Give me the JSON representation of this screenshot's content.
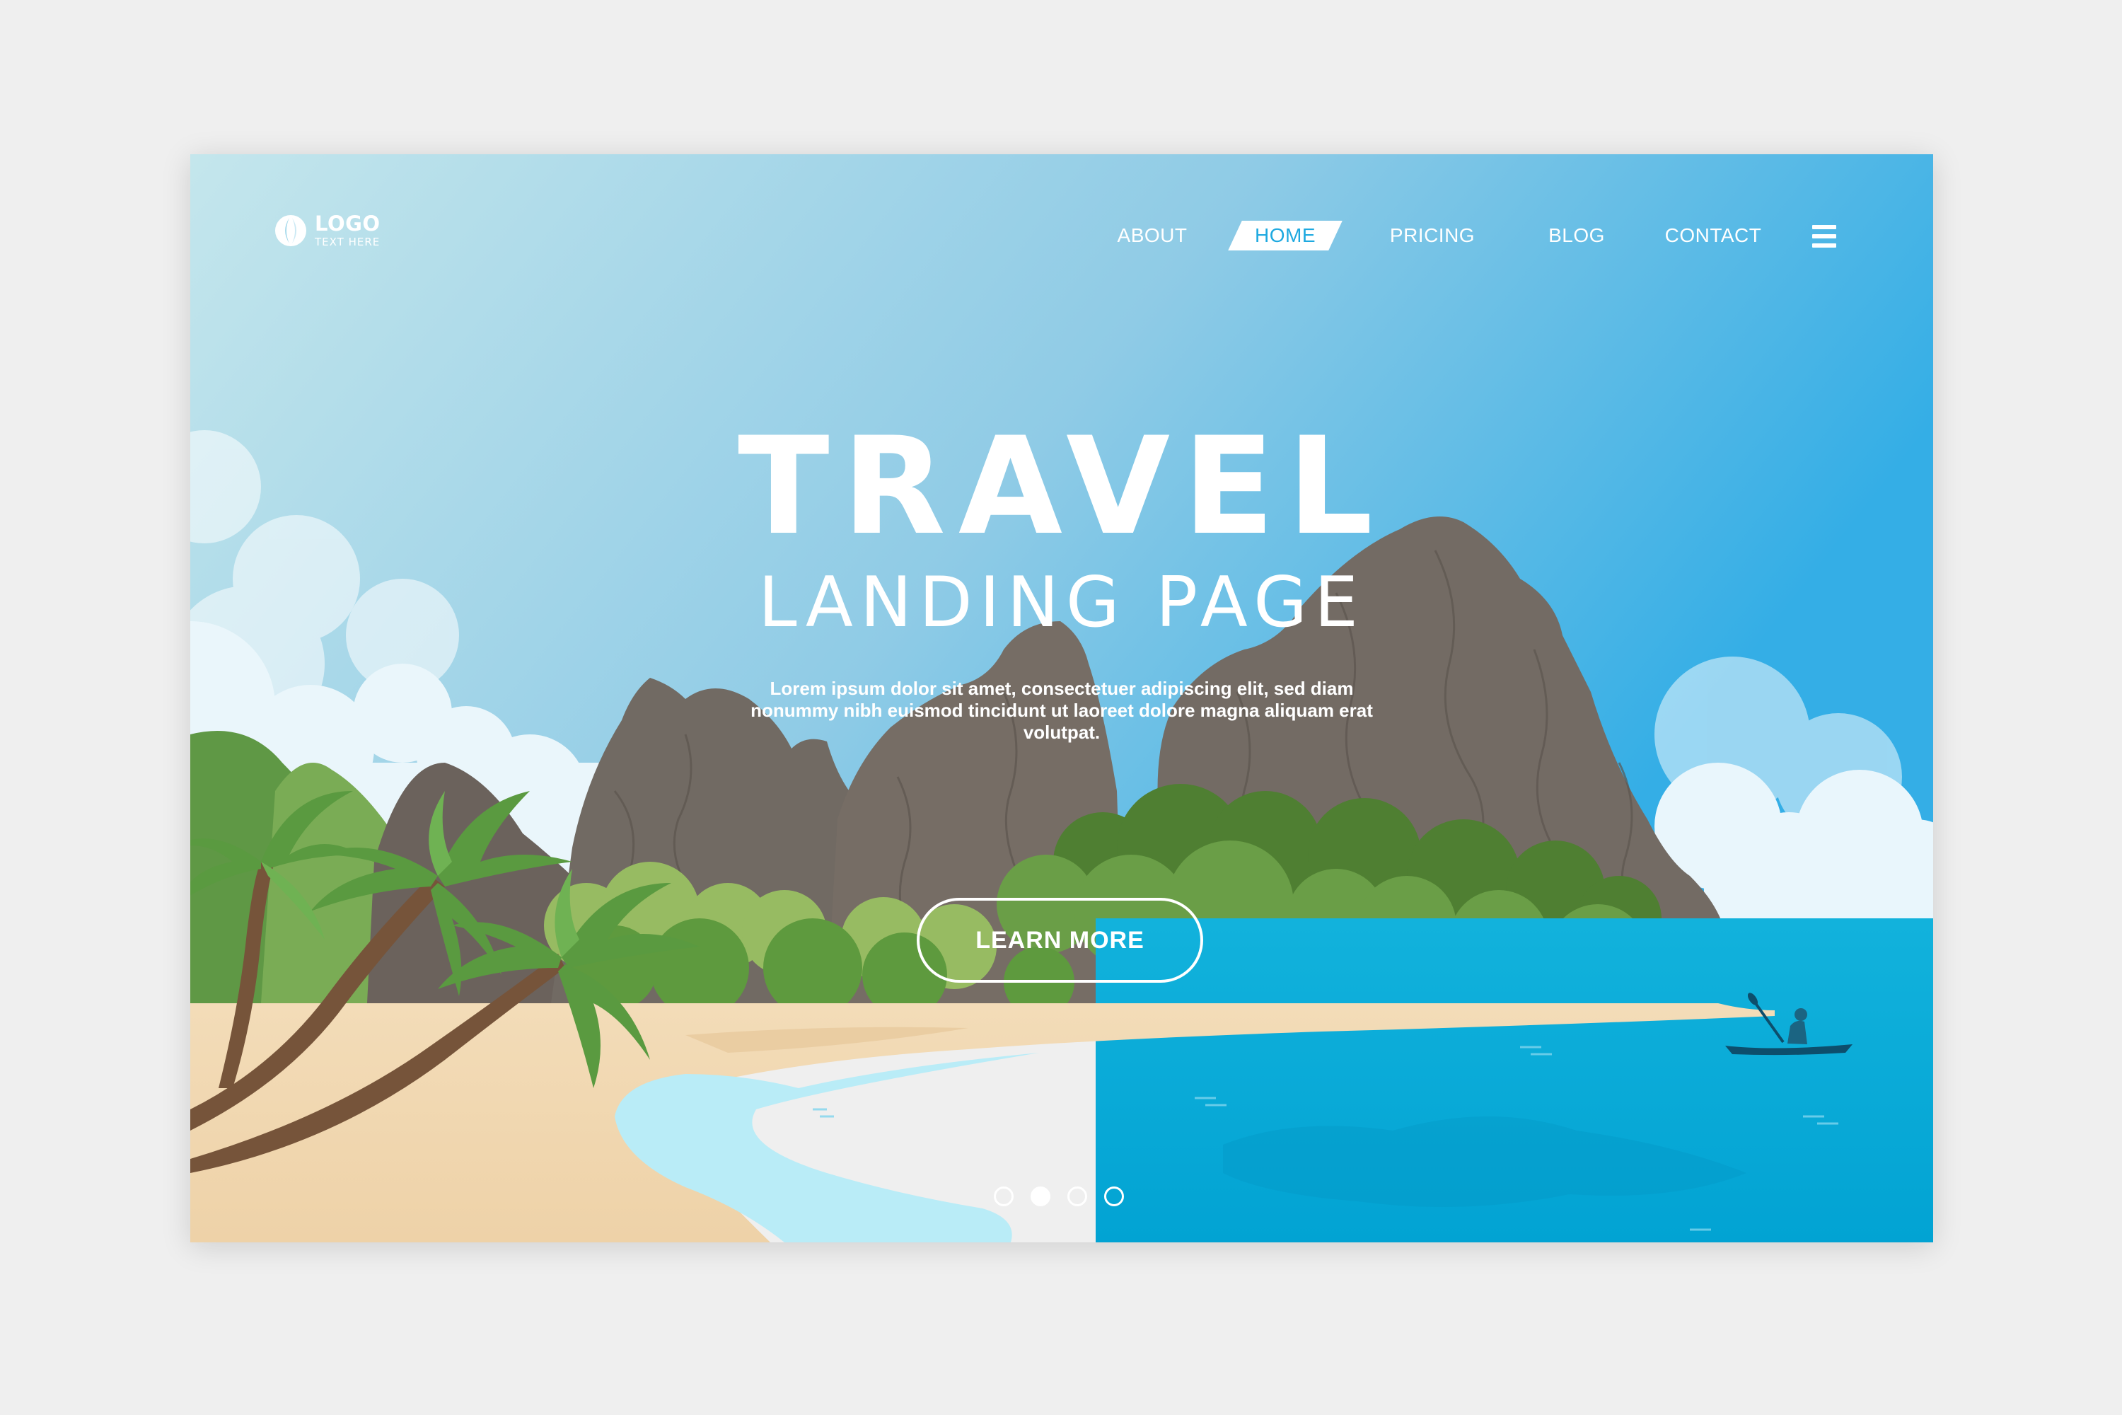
{
  "logo": {
    "title": "LOGO",
    "subtitle": "TEXT HERE",
    "icon": "logo-mark-icon"
  },
  "nav": {
    "items": [
      {
        "label": "ABOUT",
        "active": false
      },
      {
        "label": "HOME",
        "active": true
      },
      {
        "label": "PRICING",
        "active": false
      },
      {
        "label": "BLOG",
        "active": false
      },
      {
        "label": "CONTACT",
        "active": false
      }
    ],
    "menu_icon": "hamburger-menu-icon"
  },
  "hero": {
    "title": "TRAVEL",
    "subtitle": "LANDING PAGE",
    "body": "Lorem ipsum dolor sit amet, consectetuer adipiscing elit, sed diam nonummy nibh euismod tincidunt ut laoreet dolore magna aliquam erat volutpat.",
    "cta_label": "LEARN MORE"
  },
  "carousel": {
    "count": 4,
    "active_index": 1
  },
  "colors": {
    "sky_top": "#bfe3ea",
    "sky_bottom": "#3aaee3",
    "sea": "#06a9d6",
    "sand": "#f0d6b0",
    "rock": "#6e6660",
    "foliage": "#5a8f3d",
    "accent": "#1ea9e0"
  }
}
